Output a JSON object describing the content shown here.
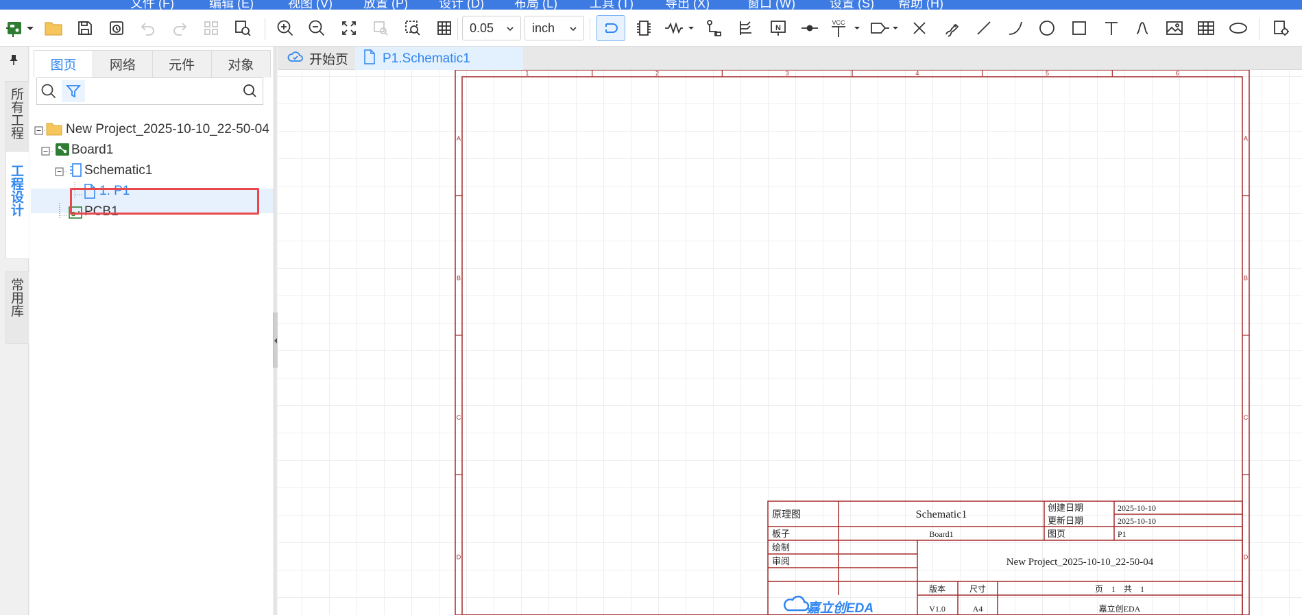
{
  "app": {
    "menu_partial": [
      "文件 (F)",
      "编辑 (E)",
      "视图 (V)",
      "放置 (P)",
      "设计 (D)",
      "布局 (L)",
      "工具 (T)",
      "导出 (X)",
      "窗口 (W)",
      "设置 (S)",
      "帮助 (H)"
    ]
  },
  "toolbar": {
    "grid_size": "0.05",
    "unit": "inch",
    "icons": [
      "new-project-icon",
      "open-folder-icon",
      "save-icon",
      "history-icon",
      "undo-icon",
      "redo-icon",
      "component-grid-icon",
      "find-icon",
      "zoom-in-icon",
      "zoom-out-icon",
      "fit-icon",
      "zoom-selection-icon",
      "area-zoom-icon",
      "grid-icon",
      "wire-icon",
      "component-icon",
      "resistor-icon",
      "net-label-icon",
      "bus-entry-icon",
      "net-flag-icon",
      "junction-icon",
      "vcc-icon",
      "port-icon",
      "no-connect-icon",
      "pen-icon",
      "line-icon",
      "arc-icon",
      "circle-icon",
      "rectangle-icon",
      "text-icon",
      "bezier-icon",
      "image-icon",
      "table-icon",
      "ellipse-icon",
      "setting-icon"
    ],
    "vcc_label": "VCC",
    "netflag_label": "N"
  },
  "vtabs": [
    {
      "label": "所有工程",
      "active": false
    },
    {
      "label": "工程设计",
      "active": true
    },
    {
      "label": "常用库",
      "active": false
    }
  ],
  "panel": {
    "tabs": [
      "图页",
      "网络",
      "元件",
      "对象"
    ],
    "active_tab": "图页",
    "search_placeholder": "",
    "tree": {
      "project": "New Project_2025-10-10_22-50-04",
      "board": "Board1",
      "schematic": "Schematic1",
      "page": "1. P1",
      "pcb": "PCB1"
    }
  },
  "doc_tabs": [
    {
      "label": "开始页",
      "icon": "cloud-icon",
      "active": false
    },
    {
      "label": "P1.Schematic1",
      "icon": "page-icon",
      "active": true
    }
  ],
  "sheet": {
    "col_labels": [
      "1",
      "2",
      "3",
      "4",
      "5",
      "6"
    ],
    "row_labels": [
      "A",
      "B",
      "C",
      "D"
    ],
    "title_block": {
      "type_label": "原理图",
      "title": "Schematic1",
      "created_label": "创建日期",
      "created": "2025-10-10",
      "updated_label": "更新日期",
      "updated": "2025-10-10",
      "board_label": "板子",
      "board": "Board1",
      "page_label": "图页",
      "page": "P1",
      "drawn_label": "绘制",
      "review_label": "审阅",
      "project": "New Project_2025-10-10_22-50-04",
      "version_label": "版本",
      "size_label": "尺寸",
      "page_count_text": "页    1    共    1",
      "version": "V1.0",
      "size": "A4",
      "company": "嘉立创EDA",
      "logo_text": "嘉立创EDA"
    }
  },
  "colors": {
    "accent": "#2f86f0",
    "menubar": "#3d7be3",
    "sheet_border": "#a52a2a",
    "highlight": "#e8474d"
  }
}
